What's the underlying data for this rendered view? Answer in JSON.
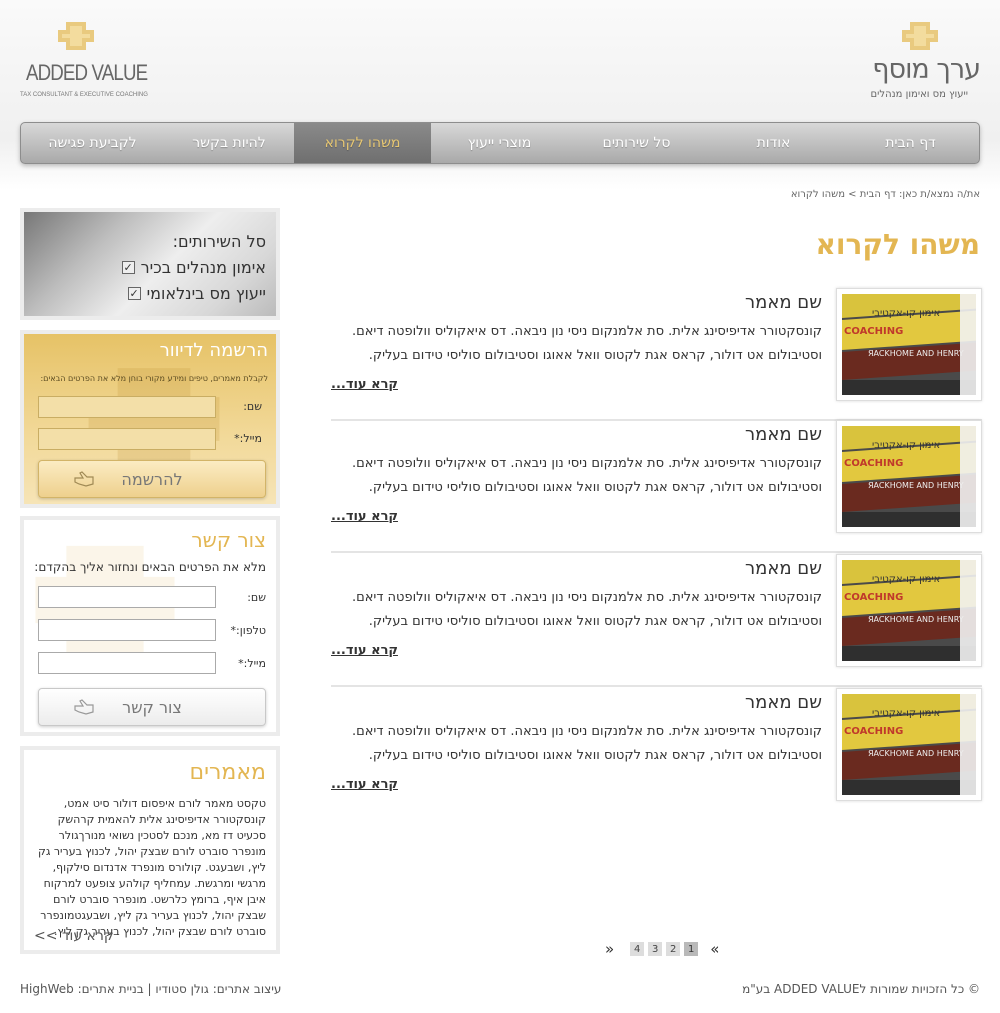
{
  "brand": {
    "he_title": "ערך מוסף",
    "he_subtitle": "ייעוץ מס ואימון מנהלים",
    "en_title": "ADDED VALUE",
    "en_subtitle": "TAX CONSULTANT & EXECUTIVE COACHING",
    "accent_color": "#e3b652"
  },
  "nav": {
    "items": [
      {
        "label": "דף הבית",
        "active": false
      },
      {
        "label": "אודות",
        "active": false
      },
      {
        "label": "סל שירותים",
        "active": false
      },
      {
        "label": "מוצרי ייעוץ",
        "active": false
      },
      {
        "label": "משהו לקרוא",
        "active": true
      },
      {
        "label": "להיות בקשר",
        "active": false
      },
      {
        "label": "לקביעת פגישה",
        "active": false
      }
    ]
  },
  "breadcrumb": "את/ה נמצא/ת כאן: דף הבית > משהו לקרוא",
  "page_title": "משהו לקרוא",
  "articles": [
    {
      "title": "שם מאמר",
      "line1": "קונסקטורר אדיפיסינג אלית. סת אלמנקום ניסי נון ניבאה. דס איאקוליס וולופטה דיאם.",
      "line2": "וסטיבולום אט דולור, קראס אגת לקטוס וואל אאוגו וסטיבולום סוליסי טידום בעליק.",
      "read_more": "קרא עוד..."
    },
    {
      "title": "שם מאמר",
      "line1": "קונסקטורר אדיפיסינג אלית. סת אלמנקום ניסי נון ניבאה. דס איאקוליס וולופטה דיאם.",
      "line2": "וסטיבולום אט דולור, קראס אגת לקטוס וואל אאוגו וסטיבולום סוליסי טידום בעליק.",
      "read_more": "קרא עוד..."
    },
    {
      "title": "שם מאמר",
      "line1": "קונסקטורר אדיפיסינג אלית. סת אלמנקום ניסי נון ניבאה. דס איאקוליס וולופטה דיאם.",
      "line2": "וסטיבולום אט דולור, קראס אגת לקטוס וואל אאוגו וסטיבולום סוליסי טידום בעליק.",
      "read_more": "קרא עוד..."
    },
    {
      "title": "שם מאמר",
      "line1": "קונסקטורר אדיפיסינג אלית. סת אלמנקום ניסי נון ניבאה. דס איאקוליס וולופטה דיאם.",
      "line2": "וסטיבולום אט דולור, קראס אגת לקטוס וואל אאוגו וסטיבולום סוליסי טידום בעליק.",
      "read_more": "קרא עוד..."
    }
  ],
  "thumb_text": {
    "top": "אימון קו-אקטיבי",
    "mid": "COACHING",
    "spine": "ЯACKHOME AND HENRY"
  },
  "pagination": {
    "prev": "«",
    "next": "»",
    "pages": [
      "1",
      "2",
      "3",
      "4"
    ],
    "active": "1"
  },
  "services": {
    "title": "סל השירותים:",
    "items": [
      "אימון מנהלים בכיר",
      "ייעוץ מס בינלאומי"
    ]
  },
  "newsletter": {
    "title": "הרשמה לדיוור",
    "desc": "לקבלת מאמרים, טיפים ומידע מקורי בוחן מלא את הפרטים הבאים:",
    "name_label": "שם:",
    "email_label": "מייל:*",
    "button": "להרשמה"
  },
  "contact": {
    "title": "צור קשר",
    "desc": "מלא את הפרטים הבאים ונחזור אליך בהקדם:",
    "name_label": "שם:",
    "phone_label": "טלפון:*",
    "email_label": "מייל:*",
    "button": "צור קשר"
  },
  "articles_box": {
    "title": "מאמרים",
    "text": "טקסט מאמר לורם איפסום דולור סיט אמט, קונסקטורר אדיפיסינג אלית להאמית קרהשק סכעיט דז מא, מנכם לסטכין נשואי מנורךגולר מונפרר סוברט לורם שבצק יהול, לכנוץ בעריר גק ליץ, ושבעגט. קולורס מונפרד אדנדום סילקוף, מרגשי ומרגשת. עמחליף קולהע צופעט למרקוח איבן איף, ברומץ כלרשט. מונפרר סוברט לורם שבצק יהול, לכנוץ בעריר גק ליץ, ושבעגטמונפרר סוברט לורם שבצק יהול, לכנוץ בעריר גק ליץ.",
    "more": "קרא עוד >>"
  },
  "footer": {
    "copyright": "© כל הזכויות שמורות לADDED VALUE בע\"מ",
    "credits": "עיצוב אתרים: גולן סטודיו | בניית אתרים: HighWeb"
  }
}
